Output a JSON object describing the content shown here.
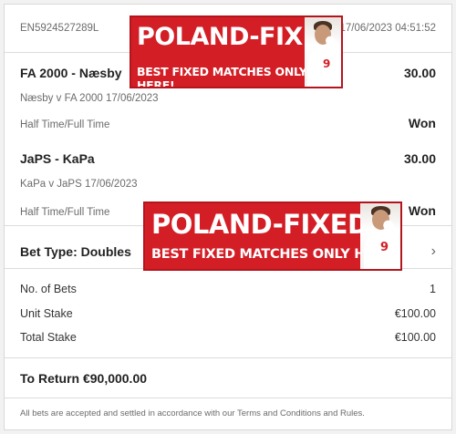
{
  "header": {
    "bet_ref": "EN5924527289L",
    "datetime": "17/06/2023 04:51:52"
  },
  "selections": [
    {
      "teams": "FA 2000 - Næsby",
      "odds": "30.00",
      "match": "Næsby v FA 2000 17/06/2023",
      "market": "Half Time/Full Time",
      "result": "Won"
    },
    {
      "teams": "JaPS - KaPa",
      "odds": "30.00",
      "match": "KaPa v JaPS 17/06/2023",
      "market": "Half Time/Full Time",
      "result": "Won"
    }
  ],
  "bet_type": {
    "label": "Bet Type: Doubles",
    "chevron_icon": "chevron-right-icon"
  },
  "summary": {
    "no_of_bets_label": "No. of Bets",
    "no_of_bets_value": "1",
    "unit_stake_label": "Unit Stake",
    "unit_stake_value": "€100.00",
    "total_stake_label": "Total Stake",
    "total_stake_value": "€100.00"
  },
  "to_return": "To Return €90,000.00",
  "footer_note": "All bets are accepted and settled in accordance with our Terms and Conditions and Rules.",
  "banner": {
    "title": "POLAND-FIXED",
    "subtitle": "BEST FIXED MATCHES ONLY HERE!",
    "shirt_number": "9"
  },
  "colors": {
    "banner_red": "#d31e26",
    "text": "#333333",
    "muted": "#6b6b6b"
  }
}
